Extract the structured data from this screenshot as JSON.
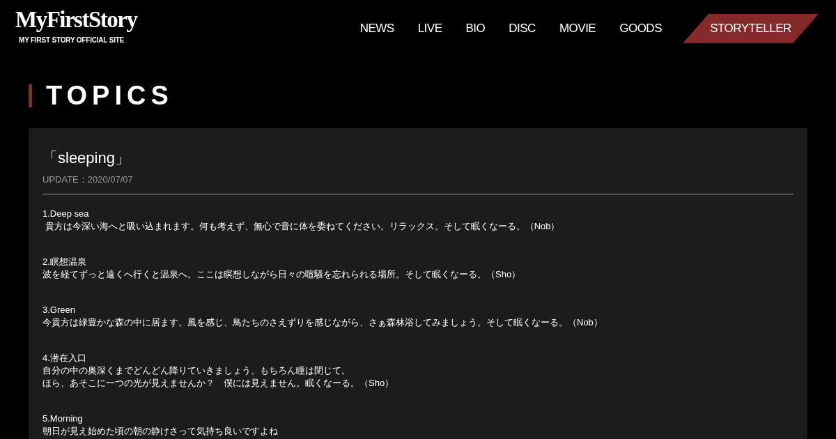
{
  "header": {
    "logo": "MyFirstStory",
    "subtitle": "MY FIRST STORY OFFICIAL SITE",
    "nav": [
      {
        "label": "NEWS",
        "kind": "link"
      },
      {
        "label": "LIVE",
        "kind": "link"
      },
      {
        "label": "BIO",
        "kind": "link"
      },
      {
        "label": "DISC",
        "kind": "link"
      },
      {
        "label": "MOVIE",
        "kind": "link"
      },
      {
        "label": "GOODS",
        "kind": "link"
      },
      {
        "label": "STORYTELLER",
        "kind": "highlight"
      }
    ]
  },
  "section": {
    "heading": "TOPICS"
  },
  "article": {
    "title": "「sleeping」",
    "update": "UPDATE：2020/07/07",
    "tracks": [
      {
        "title": "1.Deep sea",
        "lines": [
          " 貴方は今深い海へと吸い込まれます。何も考えず、無心で音に体を委ねてください。リラックス。そして眠くなーる。（Nob）"
        ]
      },
      {
        "title": "2.瞑想温泉",
        "lines": [
          "波を経てずっと遠くへ行くと温泉へ。ここは瞑想しながら日々の喧騒を忘れられる場所。そして眠くなーる。（Sho）"
        ]
      },
      {
        "title": "3.Green",
        "lines": [
          "今貴方は緑豊かな森の中に居ます。風を感じ、鳥たちのさえずりを感じながら、さぁ森林浴してみましょう。そして眠くなーる。（Nob）"
        ]
      },
      {
        "title": "4.潜在入口",
        "lines": [
          "自分の中の奥深くまでどんどん降りていきましょう。もちろん瞳は閉じて。",
          "ほら、あそこに一つの光が見えませんか？　僕には見えません。眠くなーる。（Sho）"
        ]
      },
      {
        "title": "5.Morning",
        "lines": [
          "朝日が見え始めた頃の朝の静けさって気持ち良いですよね"
        ]
      }
    ]
  }
}
